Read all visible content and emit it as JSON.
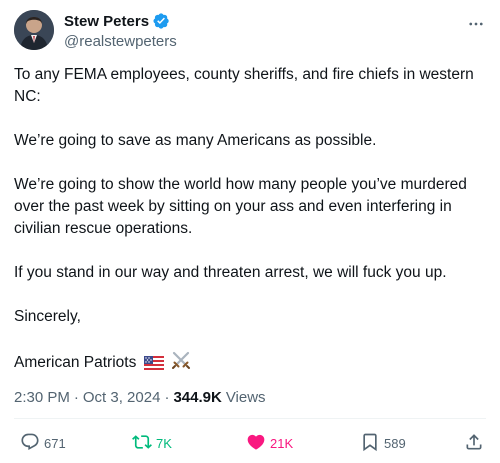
{
  "author": {
    "display_name": "Stew Peters",
    "handle": "@realstewpeters",
    "verified": true
  },
  "tweet": {
    "paragraphs": [
      "To any FEMA employees, county sheriffs, and fire chiefs in western NC:",
      "We’re going to save as many Americans as possible.",
      "We’re going to show the world how many people you’ve murdered over the past week by sitting on your ass and even interfering in civilian rescue operations.",
      "If you stand in our way and threaten arrest, we will fuck you up.",
      "Sincerely,",
      "American Patriots"
    ],
    "signature_emojis": [
      "us-flag",
      "crossed-swords"
    ]
  },
  "meta": {
    "time": "2:30 PM",
    "separator": "·",
    "date": "Oct 3, 2024",
    "views_count": "344.9K",
    "views_label": "Views"
  },
  "actions": {
    "reply_count": "671",
    "repost_count": "7K",
    "like_count": "21K",
    "bookmark_count": "589"
  },
  "colors": {
    "verified_blue": "#1d9bf0",
    "repost_green": "#00ba7c",
    "like_pink": "#f91880",
    "secondary_text": "#536471"
  },
  "icons": {
    "more": "more-dots-icon",
    "reply": "reply-bubble-icon",
    "repost": "repost-icon",
    "like": "heart-filled-icon",
    "bookmark": "bookmark-icon",
    "share": "share-upload-icon"
  }
}
